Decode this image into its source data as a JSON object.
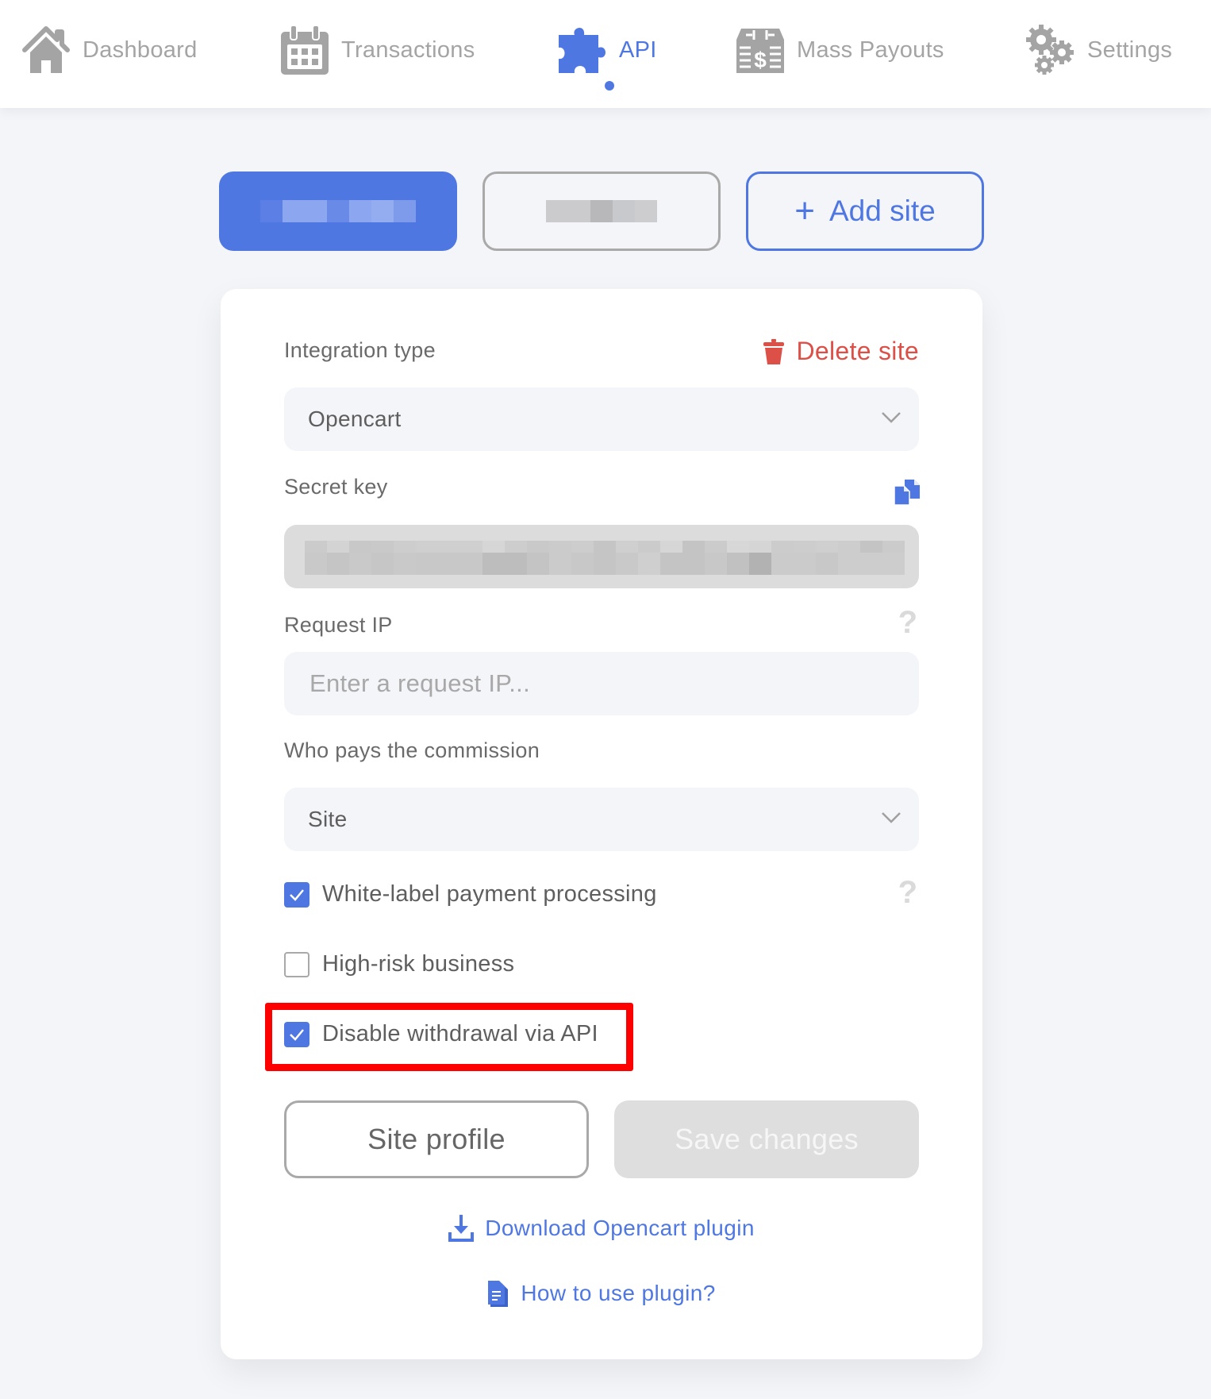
{
  "nav": {
    "items": [
      {
        "label": "Dashboard",
        "icon": "home-icon",
        "active": false
      },
      {
        "label": "Transactions",
        "icon": "calendar-icon",
        "active": false
      },
      {
        "label": "API",
        "icon": "puzzle-icon",
        "active": true
      },
      {
        "label": "Mass Payouts",
        "icon": "cash-register-icon",
        "active": false
      },
      {
        "label": "Settings",
        "icon": "gears-icon",
        "active": false
      }
    ]
  },
  "site_tabs": {
    "active_label": "[redacted]",
    "inactive_label": "[redacted]",
    "add_label": "Add site",
    "add_icon": "plus-icon"
  },
  "form": {
    "integration_type": {
      "label": "Integration type",
      "value": "Opencart",
      "icon": "chevron-down-icon"
    },
    "delete_site": {
      "label": "Delete site",
      "icon": "trash-icon"
    },
    "secret_key": {
      "label": "Secret key",
      "value": "[redacted]",
      "copy_icon": "copy-icon"
    },
    "request_ip": {
      "label": "Request IP",
      "value": "",
      "placeholder": "Enter a request IP...",
      "help_icon": "?"
    },
    "commission": {
      "label": "Who pays the commission",
      "value": "Site"
    },
    "checkboxes": [
      {
        "label": "White-label payment processing",
        "checked": true,
        "help_icon": "?"
      },
      {
        "label": "High-risk business",
        "checked": false
      },
      {
        "label": "Disable withdrawal via API",
        "checked": true,
        "highlighted": true
      }
    ],
    "buttons": {
      "site_profile": "Site profile",
      "save_changes": "Save changes"
    },
    "links": {
      "download": "Download Opencart plugin",
      "how_to": "How to use plugin?"
    }
  },
  "colors": {
    "accent": "#4f77e2",
    "danger": "#dc5048",
    "highlight": "#ff0000",
    "muted": "#a4a4a4",
    "background": "#f4f5f9"
  }
}
